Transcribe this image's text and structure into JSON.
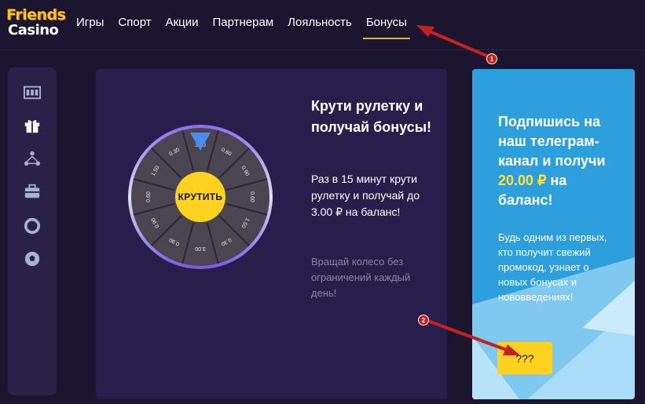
{
  "logo": {
    "line1": "Friends",
    "line2": "Casino"
  },
  "nav": {
    "items": [
      {
        "label": "Игры"
      },
      {
        "label": "Спорт"
      },
      {
        "label": "Акции"
      },
      {
        "label": "Партнерам"
      },
      {
        "label": "Лояльность"
      },
      {
        "label": "Бонусы",
        "active": true
      }
    ]
  },
  "sidebar": {
    "icons": [
      "slots-icon",
      "gift-icon",
      "referral-icon",
      "briefcase-icon",
      "lifebuoy-icon",
      "soccer-ball-icon"
    ]
  },
  "roulette": {
    "spin_label": "КРУТИТЬ",
    "segments": [
      "3.00",
      "0.60",
      "0.90",
      "0.60",
      "1.50",
      "0.30",
      "3.00",
      "0.90",
      "0.90",
      "0.60",
      "1.50",
      "0.30"
    ],
    "title": "Крути рулетку и получай бонусы!",
    "text": "Раз в 15 минут крути рулетку и получай до 3.00 ₽ на баланс!",
    "note": "Вращай колесо без ограничений каждый день!"
  },
  "telegram": {
    "title_before": "Подпишись на наш телеграм-канал и получи",
    "amount": "20.00 ₽",
    "title_after": "на баланс!",
    "text": "Будь одним из первых, кто получит свежий промокод, узнает о новых бонусах и нововведениях!",
    "button_label": "???"
  },
  "annotations": {
    "badge1": "1",
    "badge2": "2"
  },
  "colors": {
    "background": "#1b1530",
    "panel": "#281e4b",
    "accent_yellow": "#ffd21f",
    "telegram_blue": "#2e9fdd",
    "annotation_red": "#c62023"
  }
}
